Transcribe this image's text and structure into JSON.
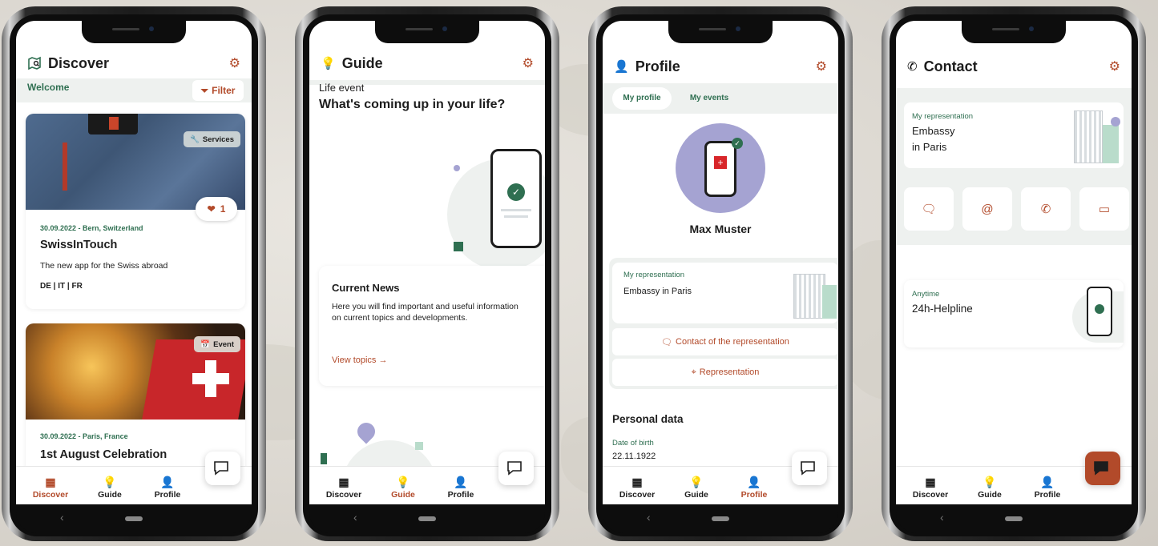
{
  "colors": {
    "accent": "#b24a2a",
    "lilac": "#a5a3d2",
    "green": "#2f6f51",
    "panel": "#eef1ef"
  },
  "screens": {
    "discover": {
      "title": "Discover",
      "welcome": "Welcome",
      "filter_label": "Filter",
      "card1": {
        "badge": "Services",
        "likes": "1",
        "meta": "30.09.2022 - Bern, Switzerland",
        "title": "SwissInTouch",
        "desc": "The new app for the Swiss abroad",
        "langs": "DE | IT | FR"
      },
      "card2": {
        "badge": "Event",
        "meta": "30.09.2022 - Paris, France",
        "title": "1st August Celebration"
      }
    },
    "guide": {
      "title": "Guide",
      "kicker": "Life event",
      "headline": "What's coming up in your life?",
      "news_title": "Current News",
      "news_text": "Here you will find important and useful information on current topics and developments.",
      "news_link": "View topics"
    },
    "profile": {
      "title": "Profile",
      "segments": [
        "My profile",
        "My events"
      ],
      "name": "Max Muster",
      "rep_label": "My representation",
      "rep_value": "Embassy in Paris",
      "contact_link": "Contact of the representation",
      "rep_link": "Representation",
      "personal_heading": "Personal data",
      "dob_label": "Date of birth",
      "dob_value": "22.11.1922"
    },
    "contact": {
      "title": "Contact",
      "rep_label": "My representation",
      "rep_value_1": "Embassy",
      "rep_value_2": "in Paris",
      "actions": [
        "chat-icon",
        "at-icon",
        "phone-icon",
        "calendar-icon"
      ],
      "help_label": "Anytime",
      "help_value": "24h-Helpline"
    }
  },
  "tabs": [
    "Discover",
    "Guide",
    "Profile"
  ]
}
